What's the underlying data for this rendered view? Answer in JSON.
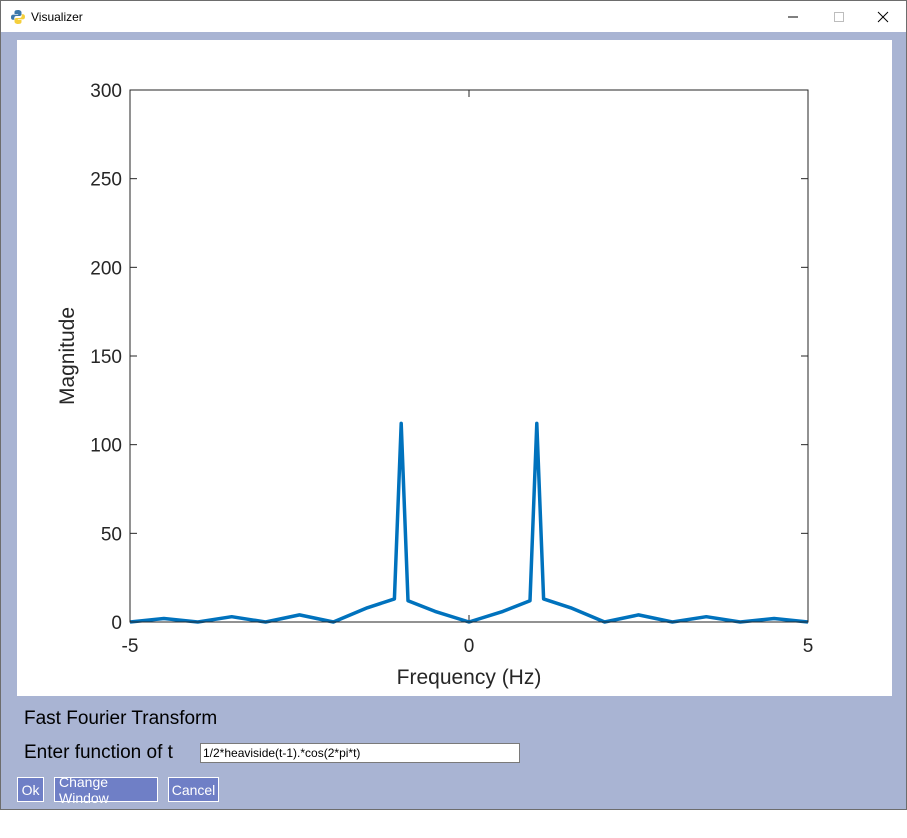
{
  "window": {
    "title": "Visualizer",
    "icon": "python-icon"
  },
  "controls": {
    "heading": "Fast Fourier Transform",
    "function_label": "Enter function of t",
    "function_value": "1/2*heaviside(t-1).*cos(2*pi*t)",
    "ok_label": "Ok",
    "change_window_label": "Change Window",
    "cancel_label": "Cancel"
  },
  "colors": {
    "background": "#a9b4d3",
    "button": "#6f7fc6",
    "series": "#0072bd"
  },
  "chart_data": {
    "type": "line",
    "xlabel": "Frequency (Hz)",
    "ylabel": "Magnitude",
    "xlim": [
      -5,
      5
    ],
    "ylim": [
      0,
      300
    ],
    "xticks": [
      -5,
      0,
      5
    ],
    "yticks": [
      0,
      50,
      100,
      150,
      200,
      250,
      300
    ],
    "grid": false,
    "series": [
      {
        "x": [
          -5,
          -4.5,
          -4,
          -3.5,
          -3,
          -2.5,
          -2,
          -1.5,
          -1.1,
          -1,
          -0.9,
          -0.5,
          0,
          0.5,
          0.9,
          1,
          1.1,
          1.5,
          2,
          2.5,
          3,
          3.5,
          4,
          4.5,
          5
        ],
        "y": [
          0,
          2,
          0,
          3,
          0,
          4,
          0,
          8,
          13,
          112,
          12,
          6,
          0,
          6,
          12,
          112,
          13,
          8,
          0,
          4,
          0,
          3,
          0,
          2,
          0
        ]
      }
    ]
  }
}
